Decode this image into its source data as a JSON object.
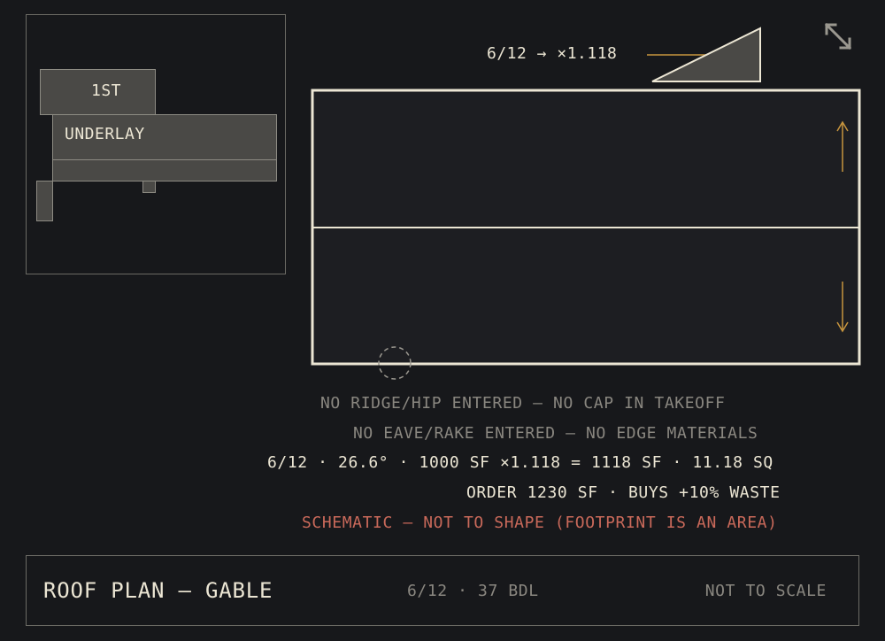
{
  "layers": {
    "first_label": "1ST",
    "underlay_label": "UNDERLAY"
  },
  "pitch": {
    "label": "6/12 → ×1.118"
  },
  "toolbar": {
    "expand_icon": "expand-arrows-icon"
  },
  "notes": {
    "no_ridge": "NO RIDGE/HIP ENTERED — NO CAP IN TAKEOFF",
    "no_eave": "NO EAVE/RAKE ENTERED — NO EDGE MATERIALS",
    "calc": "6/12 · 26.6° · 1000 SF ×1.118 = 1118 SF · 11.18 SQ",
    "order": "ORDER 1230 SF · BUYS +10% WASTE",
    "schematic": "SCHEMATIC — NOT TO SHAPE (FOOTPRINT IS AN AREA)"
  },
  "footer": {
    "title": "ROOF PLAN — GABLE",
    "pitch_bundles": "6/12 · 37 BDL",
    "scale": "NOT TO SCALE"
  },
  "colors": {
    "background": "#17181b",
    "outline": "#ece6d4",
    "slope_arrow": "#c7953e",
    "warning": "#c9695a",
    "muted": "#8a8780"
  }
}
